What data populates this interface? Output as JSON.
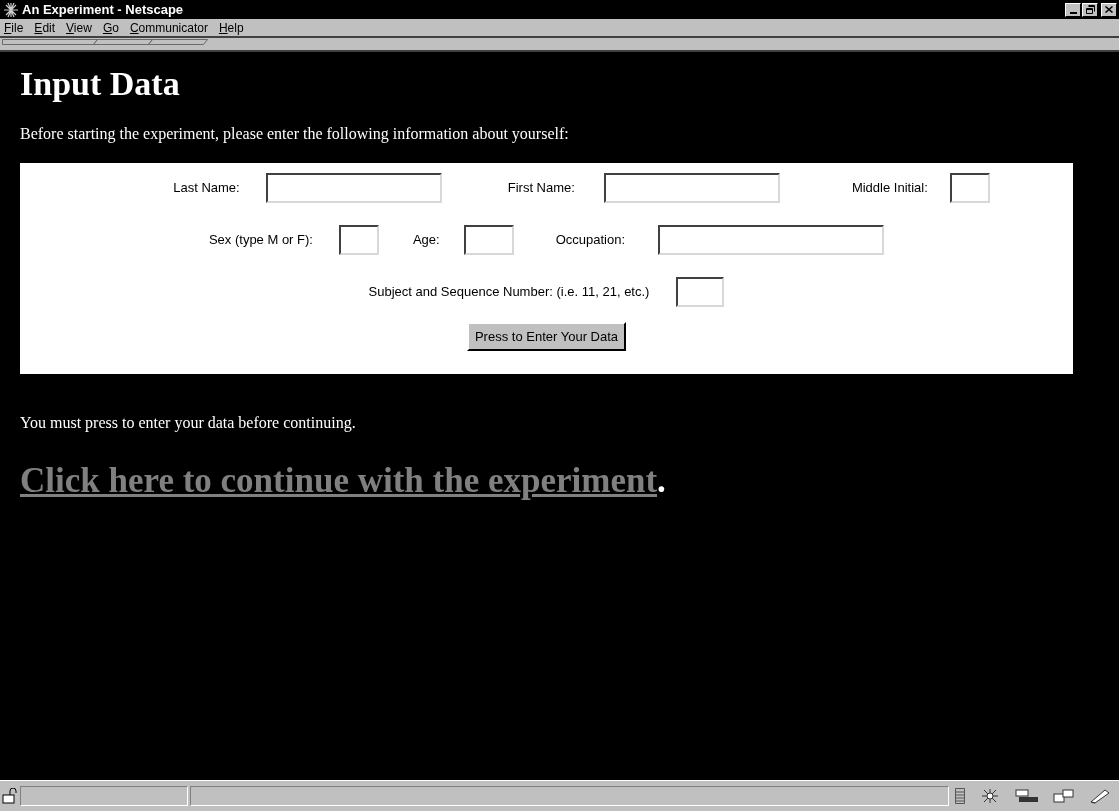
{
  "window": {
    "title": "An Experiment - Netscape"
  },
  "menu": [
    "File",
    "Edit",
    "View",
    "Go",
    "Communicator",
    "Help"
  ],
  "heading": "Input Data",
  "intro": "Before starting the experiment, please enter the following information about yourself:",
  "form": {
    "fields": [
      {
        "label": "Last Name:"
      },
      {
        "label": "First Name:"
      },
      {
        "label": "Middle Initial:"
      },
      {
        "label": "Sex (type M or F):"
      },
      {
        "label": "Age:"
      },
      {
        "label": "Occupation:"
      },
      {
        "label": "Subject and Sequence Number: (i.e. 11, 21, etc.)"
      }
    ],
    "submit": "Press to Enter Your Data"
  },
  "note": "You must press to enter your data before continuing.",
  "link": {
    "text": "Click here to continue with the experiment",
    "after": "."
  }
}
